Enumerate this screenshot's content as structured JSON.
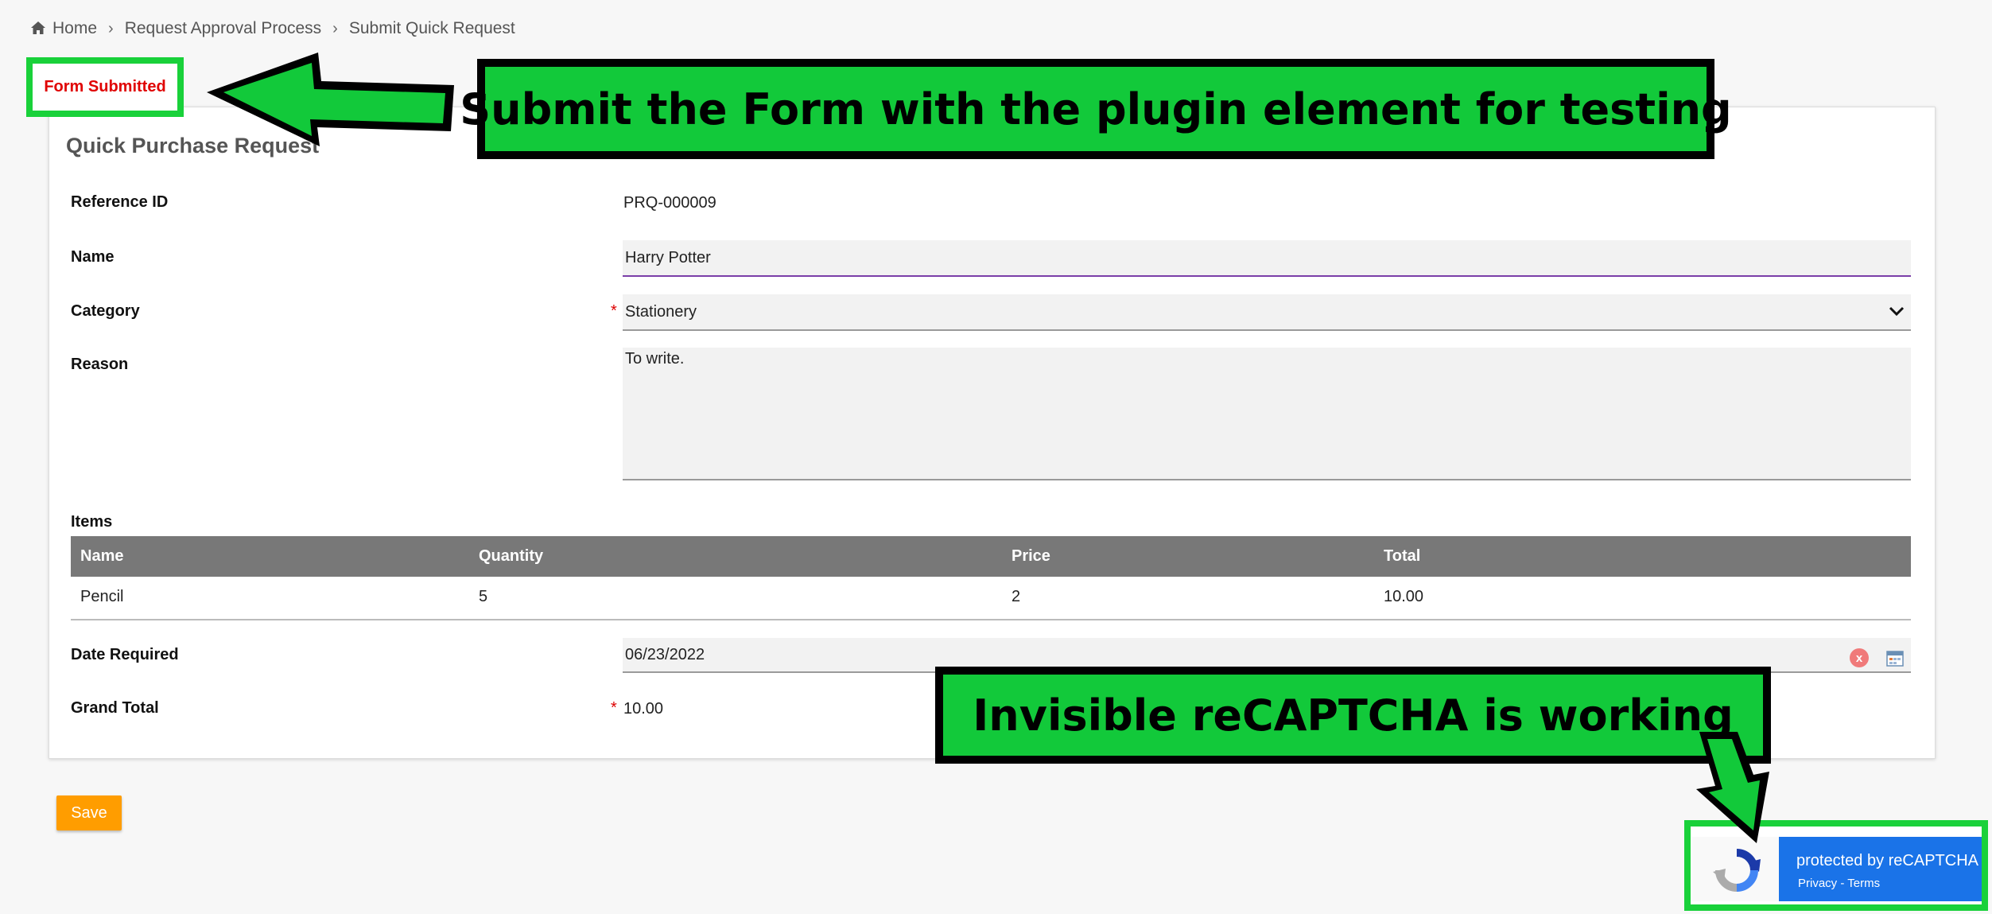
{
  "breadcrumb": {
    "home": "Home",
    "items": [
      "Request Approval Process",
      "Submit Quick Request"
    ],
    "separator": "›"
  },
  "status": {
    "message": "Form Submitted"
  },
  "annotations": {
    "callout_top": "Submit the Form with the plugin element for testing",
    "callout_bottom": "Invisible reCAPTCHA is working"
  },
  "form": {
    "title": "Quick Purchase Request",
    "reference": {
      "label": "Reference ID",
      "value": "PRQ-000009"
    },
    "name": {
      "label": "Name",
      "value": "Harry Potter"
    },
    "category": {
      "label": "Category",
      "value": "Stationery",
      "required_mark": "*"
    },
    "reason": {
      "label": "Reason",
      "value": "To write."
    },
    "items": {
      "label": "Items",
      "columns": [
        "Name",
        "Quantity",
        "Price",
        "Total"
      ],
      "rows": [
        [
          "Pencil",
          "5",
          "2",
          "10.00"
        ]
      ]
    },
    "date_required": {
      "label": "Date Required",
      "value": "06/23/2022",
      "clear_glyph": "x"
    },
    "grand_total": {
      "label": "Grand Total",
      "value": "10.00",
      "required_mark": "*"
    },
    "save_label": "Save"
  },
  "recaptcha": {
    "title": "protected by reCAPTCHA",
    "links": "Privacy - Terms"
  },
  "colors": {
    "accent_orange": "#ff9d00",
    "annotation_green": "#12c93a",
    "status_red": "#e00000",
    "table_header": "#787878",
    "recaptcha_blue": "#1a73e8"
  },
  "icons": [
    "home-icon",
    "chevron-down-icon",
    "clear-icon",
    "calendar-icon",
    "recaptcha-logo-icon",
    "arrow-left-icon",
    "arrow-down-icon"
  ]
}
